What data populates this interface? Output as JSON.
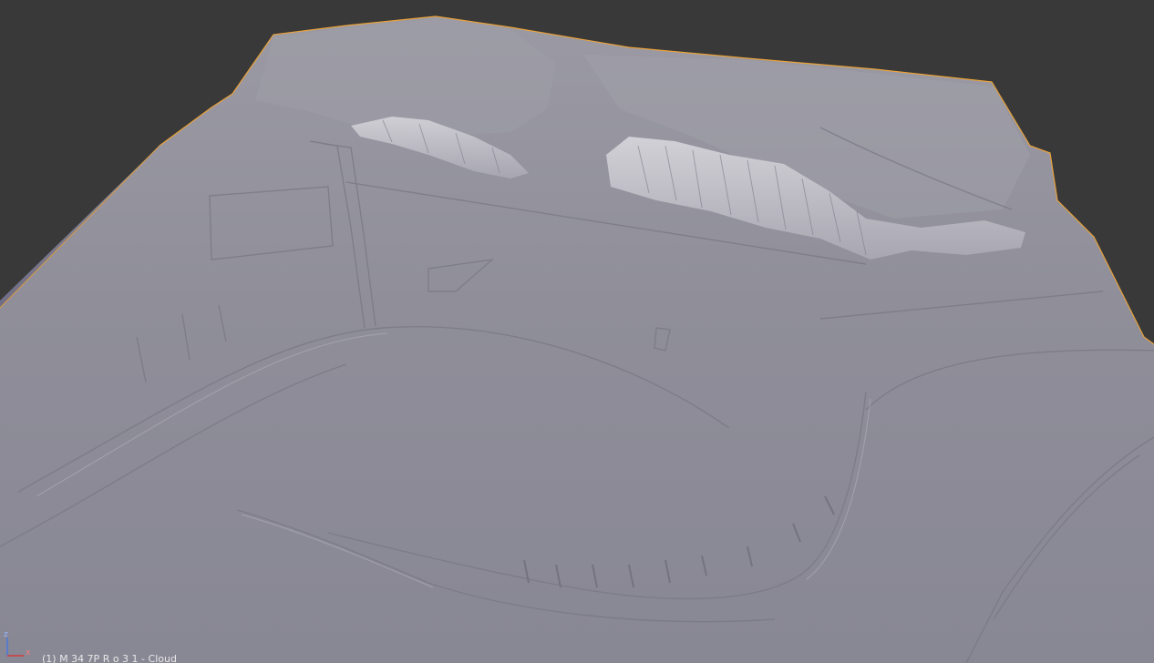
{
  "viewport": {
    "object_label": "(1) M 34 7P R o 3 1 - Cloud",
    "axes": {
      "x": "x",
      "z": "z"
    },
    "icons": {
      "gizmo": "axis-gizmo-icon"
    },
    "colors": {
      "background": "#393939",
      "mesh_fill": "#8e8d98",
      "mesh_shadow": "#6f6e7a",
      "mesh_highlight": "#c9c8cf",
      "selection_outline": "#e8a13a",
      "axis_x": "#d23a3a",
      "axis_z": "#4a78e0"
    }
  }
}
